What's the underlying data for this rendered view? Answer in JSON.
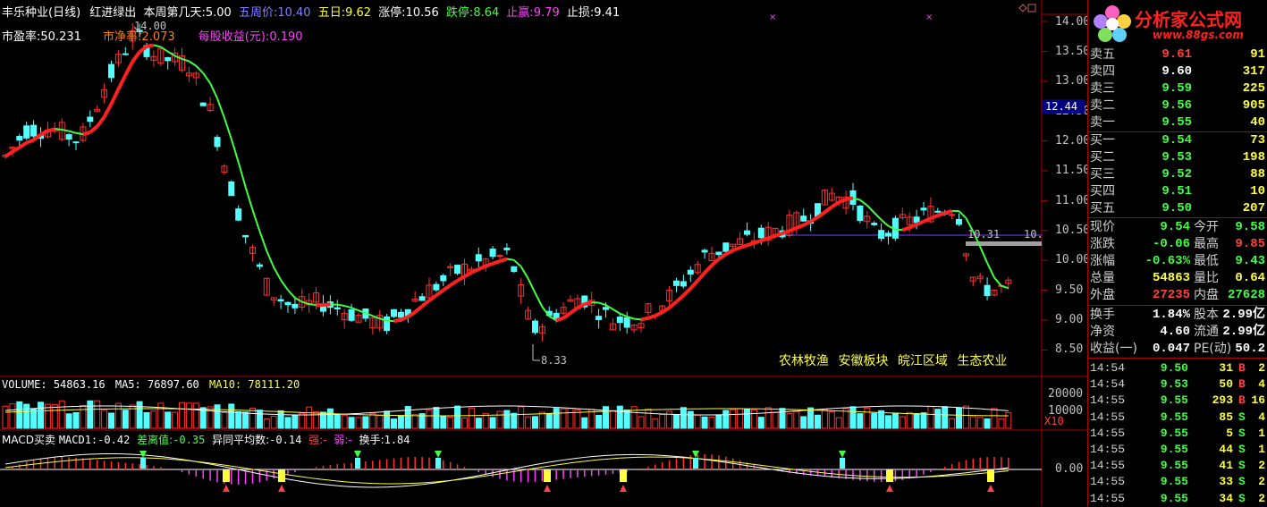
{
  "header": {
    "title": "丰乐种业(日线)",
    "indicator_label": "红进绿出",
    "week_day_label": "本周第几天:",
    "week_day_value": "5.00",
    "wzj_label": "五周价:",
    "wzj_value": "10.40",
    "wr_label": "五日:",
    "wr_value": "9.62",
    "zt_label": "涨停:",
    "zt_value": "10.56",
    "dt_label": "跌停:",
    "dt_value": "8.64",
    "zy_label": "止赢:",
    "zy_value": "9.79",
    "zs_label": "止损:",
    "zs_value": "9.41"
  },
  "subheader": {
    "pe_label": "市盈率:",
    "pe_value": "50.231",
    "pb_label": "市净率:",
    "pb_value": "2.073",
    "eps_label": "每股收益(元):",
    "eps_value": "0.190"
  },
  "price_axis": [
    "14.00",
    "13.50",
    "13.00",
    "12.50",
    "12.00",
    "11.50",
    "11.00",
    "10.50",
    "10.00",
    "9.50",
    "9.00",
    "8.50"
  ],
  "current_price_tag": "12.44",
  "annotations": {
    "high": "14.00",
    "low": "8.33",
    "line_level": "10.31",
    "line_level_right": "10."
  },
  "sector_tags": [
    "农林牧渔",
    "安徽板块",
    "皖江区域",
    "生态农业"
  ],
  "volume": {
    "label": "VOLUME:",
    "value": "54863.16",
    "ma5_label": "MA5:",
    "ma5_value": "76897.60",
    "ma10_label": "MA10:",
    "ma10_value": "78111.20",
    "axis": [
      "20000",
      "10000"
    ],
    "unit": "X10"
  },
  "macd": {
    "label": "MACD买卖",
    "macd1_label": "MACD1:",
    "macd1_value": "-0.42",
    "diff_label": "差离值:",
    "diff_value": "-0.35",
    "avg_label": "异同平均数:",
    "avg_value": "-0.14",
    "strong_label": "强:",
    "strong_value": "-",
    "weak_label": "弱:",
    "weak_value": "-",
    "turnover_label": "换手:",
    "turnover_value": "1.84",
    "axis": "0.00"
  },
  "logo": {
    "text": "分析家公式网",
    "url": "www.88gs.com"
  },
  "order_book": {
    "sells": [
      {
        "label": "卖五",
        "price": "9.61",
        "vol": "91"
      },
      {
        "label": "卖四",
        "price": "9.60",
        "vol": "317"
      },
      {
        "label": "卖三",
        "price": "9.59",
        "vol": "225"
      },
      {
        "label": "卖二",
        "price": "9.56",
        "vol": "905"
      },
      {
        "label": "卖一",
        "price": "9.55",
        "vol": "40"
      }
    ],
    "buys": [
      {
        "label": "买一",
        "price": "9.54",
        "vol": "73"
      },
      {
        "label": "买二",
        "price": "9.53",
        "vol": "198"
      },
      {
        "label": "买三",
        "price": "9.52",
        "vol": "88"
      },
      {
        "label": "买四",
        "price": "9.51",
        "vol": "10"
      },
      {
        "label": "买五",
        "price": "9.50",
        "vol": "207"
      }
    ]
  },
  "stats": [
    {
      "l1": "现价",
      "v1": "9.54",
      "c1": "#40ff40",
      "l2": "今开",
      "v2": "9.58",
      "c2": "#40ff40"
    },
    {
      "l1": "涨跌",
      "v1": "-0.06",
      "c1": "#40ff40",
      "l2": "最高",
      "v2": "9.85",
      "c2": "#ff4040"
    },
    {
      "l1": "涨幅",
      "v1": "-0.63%",
      "c1": "#40ff40",
      "l2": "最低",
      "v2": "9.43",
      "c2": "#40ff40"
    },
    {
      "l1": "总量",
      "v1": "54863",
      "c1": "#ffff40",
      "l2": "量比",
      "v2": "0.64",
      "c2": "#ffff40"
    },
    {
      "l1": "外盘",
      "v1": "27235",
      "c1": "#ff4040",
      "l2": "内盘",
      "v2": "27628",
      "c2": "#40ff40"
    },
    {
      "l1": "换手",
      "v1": "1.84%",
      "c1": "#ffffff",
      "l2": "股本",
      "v2": "2.99亿",
      "c2": "#ffffff"
    },
    {
      "l1": "净资",
      "v1": "4.60",
      "c1": "#ffffff",
      "l2": "流通",
      "v2": "2.99亿",
      "c2": "#ffffff"
    },
    {
      "l1": "收益(一)",
      "v1": "0.047",
      "c1": "#ffffff",
      "l2": "PE(动)",
      "v2": "50.2",
      "c2": "#ffffff"
    }
  ],
  "ticks": [
    {
      "time": "14:54",
      "price": "9.50",
      "vol": "31",
      "side": "B",
      "num": "2"
    },
    {
      "time": "14:54",
      "price": "9.53",
      "vol": "50",
      "side": "B",
      "num": "4"
    },
    {
      "time": "14:55",
      "price": "9.55",
      "vol": "293",
      "side": "B",
      "num": "16"
    },
    {
      "time": "14:55",
      "price": "9.55",
      "vol": "85",
      "side": "S",
      "num": "4"
    },
    {
      "time": "14:55",
      "price": "9.55",
      "vol": "5",
      "side": "S",
      "num": "1"
    },
    {
      "time": "14:55",
      "price": "9.55",
      "vol": "44",
      "side": "S",
      "num": "1"
    },
    {
      "time": "14:55",
      "price": "9.55",
      "vol": "41",
      "side": "S",
      "num": "2"
    },
    {
      "time": "14:55",
      "price": "9.55",
      "vol": "33",
      "side": "S",
      "num": "2"
    },
    {
      "time": "14:55",
      "price": "9.55",
      "vol": "34",
      "side": "S",
      "num": "2"
    }
  ],
  "colors": {
    "up": "#ff3030",
    "down": "#54ffff",
    "ma_up": "#ff2020",
    "ma_down": "#40ff40",
    "frame": "#b00000"
  }
}
